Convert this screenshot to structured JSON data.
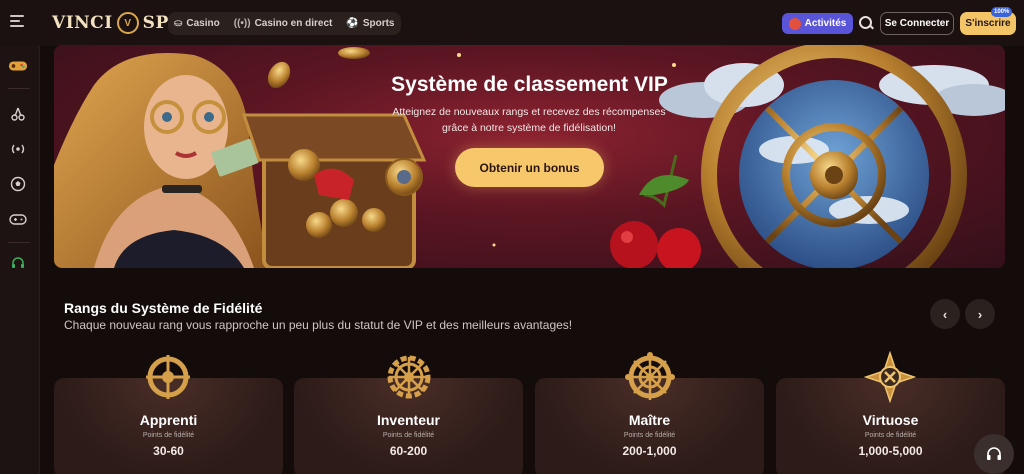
{
  "header": {
    "logo_left": "VINCI",
    "logo_mid": "V",
    "logo_right": "SPIN",
    "nav": [
      {
        "label": "Casino",
        "icon": "chip-icon"
      },
      {
        "label": "Casino en direct",
        "icon": "live-icon"
      },
      {
        "label": "Sports",
        "icon": "ball-icon"
      }
    ],
    "activities_label": "Activités",
    "login_label": "Se Connecter",
    "register_label": "S'inscrire",
    "register_badge": "100%"
  },
  "sidebar": {
    "items": [
      {
        "icon": "gamepad-promo-icon"
      },
      {
        "icon": "cherries-icon"
      },
      {
        "icon": "live-icon"
      },
      {
        "icon": "soccer-ball-icon"
      },
      {
        "icon": "joystick-icon"
      },
      {
        "icon": "headset-icon"
      }
    ]
  },
  "banner": {
    "title": "Système de classement VIP",
    "subtitle": "Atteignez de nouveaux rangs et recevez des récompenses grâce à notre système de fidélisation!",
    "cta": "Obtenir un bonus"
  },
  "ranks": {
    "title": "Rangs du Système de Fidélité",
    "subtitle": "Chaque nouveau rang vous rapproche un peu plus du statut de VIP et des meilleurs avantages!",
    "items": [
      {
        "name": "Apprenti",
        "points_label": "Points de fidélité",
        "points": "30-60",
        "icon": "wheel-icon"
      },
      {
        "name": "Inventeur",
        "points_label": "Points de fidélité",
        "points": "60-200",
        "icon": "gear-wheel-icon"
      },
      {
        "name": "Maître",
        "points_label": "Points de fidélité",
        "points": "200-1,000",
        "icon": "ornate-wheel-icon"
      },
      {
        "name": "Virtuose",
        "points_label": "Points de fidélité",
        "points": "1,000-5,000",
        "icon": "compass-star-icon"
      }
    ]
  },
  "colors": {
    "accent": "#f6c86b",
    "activities": "#5a54d8",
    "background": "#140c0b"
  }
}
